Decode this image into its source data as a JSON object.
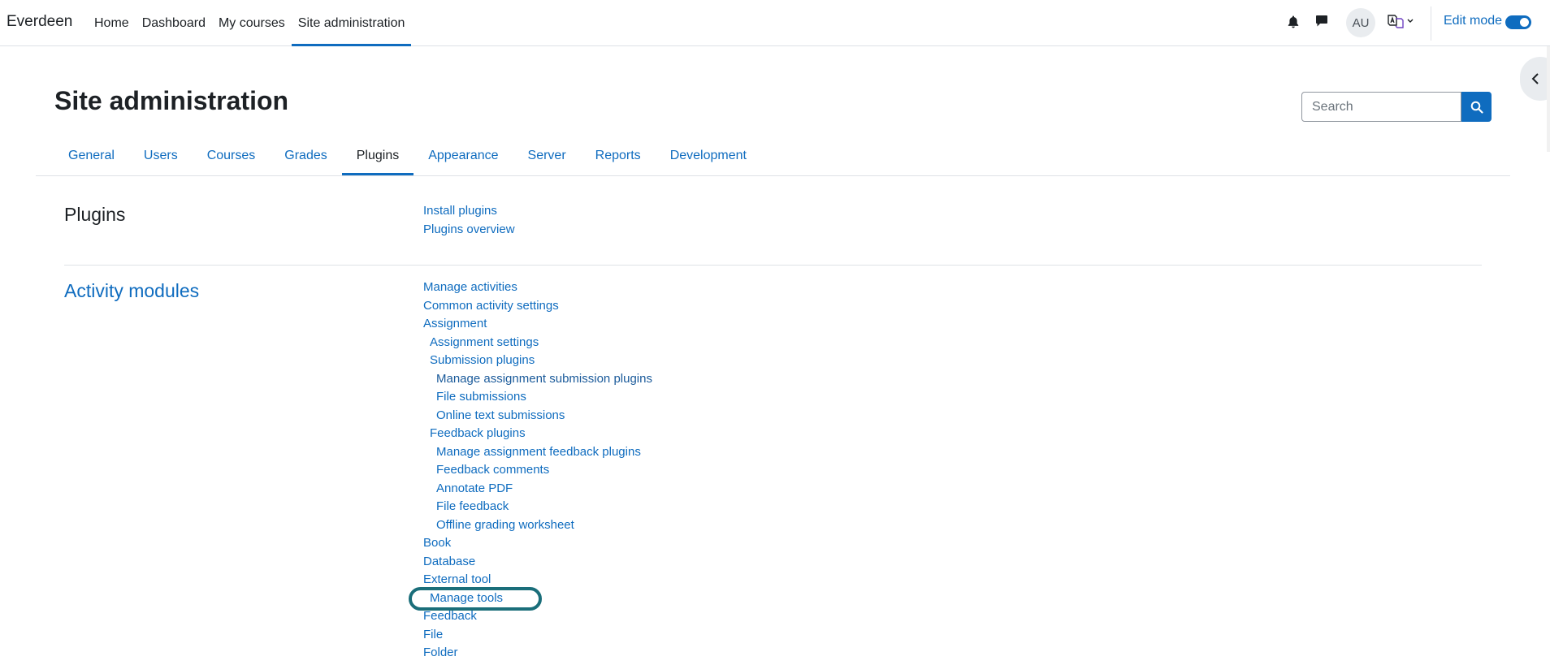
{
  "brand": "Everdeen",
  "primary_nav": {
    "items": [
      {
        "label": "Home"
      },
      {
        "label": "Dashboard"
      },
      {
        "label": "My courses"
      },
      {
        "label": "Site administration"
      }
    ]
  },
  "user_menu": {
    "initials": "AU"
  },
  "edit_mode": {
    "label": "Edit mode",
    "on": true
  },
  "page": {
    "title": "Site administration"
  },
  "search": {
    "placeholder": "Search"
  },
  "tabs": [
    {
      "label": "General"
    },
    {
      "label": "Users"
    },
    {
      "label": "Courses"
    },
    {
      "label": "Grades"
    },
    {
      "label": "Plugins"
    },
    {
      "label": "Appearance"
    },
    {
      "label": "Server"
    },
    {
      "label": "Reports"
    },
    {
      "label": "Development"
    }
  ],
  "sections": {
    "plugins": {
      "title": "Plugins",
      "links": [
        "Install plugins",
        "Plugins overview"
      ]
    },
    "activity_modules": {
      "title": "Activity modules",
      "links": [
        "Manage activities",
        "Common activity settings",
        "Assignment",
        "Assignment settings",
        "Submission plugins",
        "Manage assignment submission plugins",
        "File submissions",
        "Online text submissions",
        "Feedback plugins",
        "Manage assignment feedback plugins",
        "Feedback comments",
        "Annotate PDF",
        "File feedback",
        "Offline grading worksheet",
        "Book",
        "Database",
        "External tool",
        "Manage tools",
        "Feedback",
        "File",
        "Folder"
      ]
    }
  },
  "colors": {
    "accent": "#0f6cbf",
    "highlight_ring": "#1a6e7a"
  },
  "icons": [
    "bell-icon",
    "chat-icon",
    "language-icon",
    "search-icon",
    "chevron-left-icon"
  ]
}
